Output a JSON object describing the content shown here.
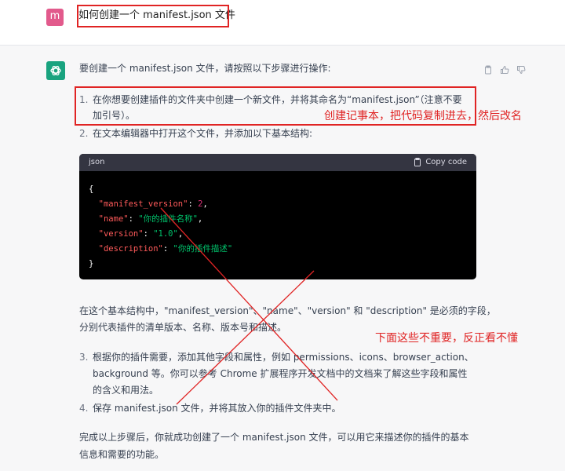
{
  "user": {
    "avatar_letter": "m",
    "message": "如何创建一个 manifest.json 文件"
  },
  "assistant": {
    "intro": "要创建一个 manifest.json 文件，请按照以下步骤进行操作:",
    "steps": [
      {
        "num": "1.",
        "line1": "在你想要创建插件的文件夹中创建一个新文件，并将其命名为“manifest.json”（注意不要",
        "line2": "加引号）。"
      },
      {
        "num": "2.",
        "line1": "在文本编辑器中打开这个文件，并添加以下基本结构:"
      }
    ],
    "code": {
      "lang": "json",
      "copy_label": "Copy code",
      "open": "{",
      "close": "}",
      "lines": [
        {
          "key": "\"manifest_version\"",
          "val": "2",
          "type": "num",
          "comma": ","
        },
        {
          "key": "\"name\"",
          "val": "\"你的插件名称\"",
          "type": "str",
          "comma": ","
        },
        {
          "key": "\"version\"",
          "val": "\"1.0\"",
          "type": "str",
          "comma": ","
        },
        {
          "key": "\"description\"",
          "val": "\"你的插件描述\"",
          "type": "str",
          "comma": ""
        }
      ]
    },
    "para1_line1": "在这个基本结构中，\"manifest_version\"、\"name\"、\"version\" 和 \"description\" 是必须的字段，",
    "para1_line2": "分别代表插件的清单版本、名称、版本号和描述。",
    "steps2": [
      {
        "num": "3.",
        "line1": "根据你的插件需要，添加其他字段和属性，例如 permissions、icons、browser_action、",
        "line2": "background 等。你可以参考 Chrome 扩展程序开发文档中的文档来了解这些字段和属性",
        "line3": "的含义和用法。"
      },
      {
        "num": "4.",
        "line1": "保存 manifest.json 文件，并将其放入你的插件文件夹中。"
      }
    ],
    "para2_line1": "完成以上步骤后，你就成功创建了一个 manifest.json 文件，可以用它来描述你的插件的基本",
    "para2_line2": "信息和需要的功能。"
  },
  "annotations": {
    "note1": "创建记事本，把代码复制进去，然后改名",
    "note2": "下面这些不重要，反正看不懂"
  },
  "colors": {
    "annotation_red": "#e02424",
    "assistant_green": "#19a37f",
    "user_avatar": "#e25a8c"
  },
  "icons": [
    "openai-logo-icon",
    "clipboard-icon",
    "thumbs-up-icon",
    "thumbs-down-icon",
    "copy-icon"
  ]
}
